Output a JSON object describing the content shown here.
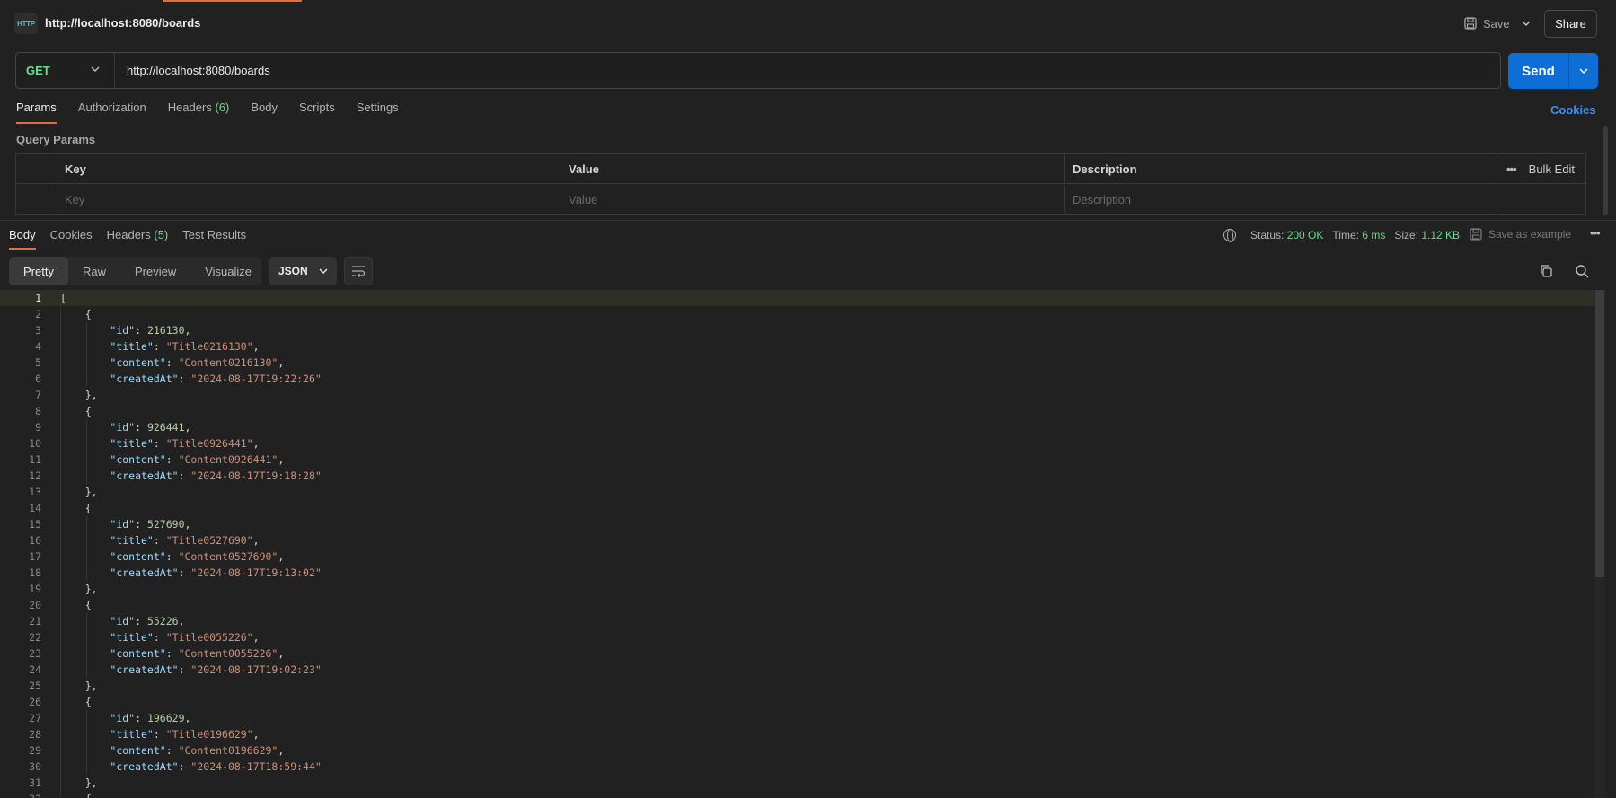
{
  "header": {
    "title": "http://localhost:8080/boards",
    "badge": "HTTP",
    "save_label": "Save",
    "share_label": "Share"
  },
  "request": {
    "method": "GET",
    "url": "http://localhost:8080/boards",
    "send_label": "Send"
  },
  "request_tabs": [
    {
      "label": "Params",
      "count": ""
    },
    {
      "label": "Authorization",
      "count": ""
    },
    {
      "label": "Headers",
      "count": "(6)"
    },
    {
      "label": "Body",
      "count": ""
    },
    {
      "label": "Scripts",
      "count": ""
    },
    {
      "label": "Settings",
      "count": ""
    }
  ],
  "cookies_label": "Cookies",
  "query_params": {
    "section_label": "Query Params",
    "columns": [
      "Key",
      "Value",
      "Description"
    ],
    "bulk_edit_label": "Bulk Edit",
    "placeholders": {
      "key": "Key",
      "value": "Value",
      "description": "Description"
    }
  },
  "response_tabs": [
    {
      "label": "Body",
      "count": ""
    },
    {
      "label": "Cookies",
      "count": ""
    },
    {
      "label": "Headers",
      "count": "(5)"
    },
    {
      "label": "Test Results",
      "count": ""
    }
  ],
  "response_status": {
    "status_label": "Status:",
    "status_value": "200 OK",
    "time_label": "Time:",
    "time_value": "6 ms",
    "size_label": "Size:",
    "size_value": "1.12 KB",
    "save_example_label": "Save as example"
  },
  "view_modes": [
    "Pretty",
    "Raw",
    "Preview",
    "Visualize"
  ],
  "format": "JSON",
  "response_body": [
    {
      "id": 216130,
      "title": "Title0216130",
      "content": "Content0216130",
      "createdAt": "2024-08-17T19:22:26"
    },
    {
      "id": 926441,
      "title": "Title0926441",
      "content": "Content0926441",
      "createdAt": "2024-08-17T19:18:28"
    },
    {
      "id": 527690,
      "title": "Title0527690",
      "content": "Content0527690",
      "createdAt": "2024-08-17T19:13:02"
    },
    {
      "id": 55226,
      "title": "Title0055226",
      "content": "Content0055226",
      "createdAt": "2024-08-17T19:02:23"
    },
    {
      "id": 196629,
      "title": "Title0196629",
      "content": "Content0196629",
      "createdAt": "2024-08-17T18:59:44"
    }
  ],
  "colors": {
    "accent": "#e26d3d",
    "send": "#0d6ed6",
    "method_get": "#6bdd8f",
    "link": "#3d8ff5"
  }
}
